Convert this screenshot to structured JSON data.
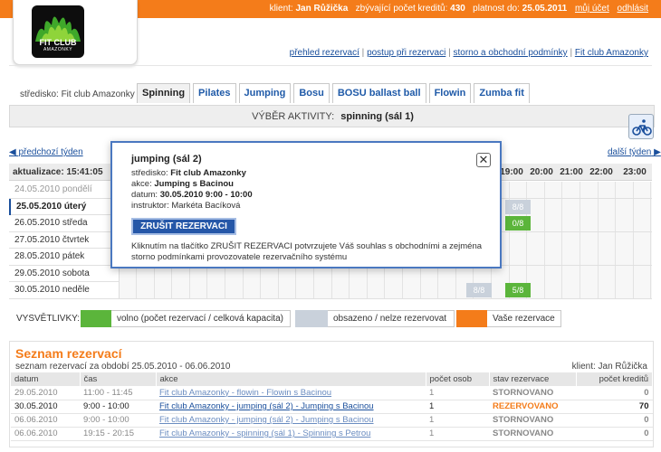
{
  "header": {
    "client_label": "klient:",
    "client_name": "Jan Růžička",
    "credits_label": "zbývající počet kreditů:",
    "credits_value": "430",
    "valid_label": "platnost do:",
    "valid_value": "25.05.2011",
    "my_account": "můj účet",
    "logout": "odhlásit"
  },
  "logo": {
    "line1": "FIT CLUB",
    "line2": "AMAZONKY"
  },
  "top_links": [
    "přehled rezervací",
    "postup při rezervaci",
    "storno a obchodní podmínky",
    "Fit club Amazonky"
  ],
  "stredisko_label": "středisko: Fit club Amazonky",
  "tabs": [
    "Spinning",
    "Pilates",
    "Jumping",
    "Bosu",
    "BOSU ballast ball",
    "Flowin",
    "Zumba fit"
  ],
  "activity": {
    "label": "VÝBĚR AKTIVITY:",
    "value": "spinning (sál 1)"
  },
  "nav": {
    "prev": "předchozí týden",
    "next": "další týden"
  },
  "grid": {
    "update_label": "aktualizace: 15:41:05",
    "hours": [
      "19:00",
      "20:00",
      "21:00",
      "22:00",
      "23:00"
    ],
    "days": [
      {
        "label": "24.05.2010 pondělí",
        "state": "past"
      },
      {
        "label": "25.05.2010 úterý",
        "state": "current"
      },
      {
        "label": "26.05.2010 středa",
        "state": ""
      },
      {
        "label": "27.05.2010 čtvrtek",
        "state": ""
      },
      {
        "label": "28.05.2010 pátek",
        "state": ""
      },
      {
        "label": "29.05.2010 sobota",
        "state": ""
      },
      {
        "label": "30.05.2010 neděle",
        "state": ""
      }
    ],
    "slots": [
      {
        "day": 1,
        "hour_index": 0,
        "text": "8/8",
        "kind": "full"
      },
      {
        "day": 2,
        "hour_index": 0,
        "text": "0/8",
        "kind": "free"
      },
      {
        "day": 6,
        "hour_index": -1,
        "text": "8/8",
        "kind": "full"
      },
      {
        "day": 6,
        "hour_index": 0,
        "text": "5/8",
        "kind": "free"
      }
    ]
  },
  "legend": {
    "title": "VYSVĚTLIVKY:",
    "items": [
      "volno (počet rezervací / celková kapacita)",
      "obsazeno / nelze rezervovat",
      "Vaše rezervace"
    ],
    "colors": {
      "free": "#5bb53b",
      "full": "#c9d1db",
      "mine": "#f47c1a"
    }
  },
  "seznam": {
    "title": "Seznam rezervací",
    "subtitle": "seznam rezervací za období 25.05.2010 - 06.06.2010",
    "client": "klient: Jan Růžička",
    "columns": [
      "datum",
      "čas",
      "akce",
      "počet osob",
      "stav rezervace",
      "počet kreditů"
    ],
    "rows": [
      {
        "datum": "29.05.2010",
        "cas": "11:00 - 11:45",
        "akce": "Fit club Amazonky - flowin - Flowin s Bacinou",
        "osob": "1",
        "stav": "STORNOVANO",
        "kredity": "0",
        "active": false
      },
      {
        "datum": "30.05.2010",
        "cas": "9:00 - 10:00",
        "akce": "Fit club Amazonky - jumping (sál 2) - Jumping s Bacinou",
        "osob": "1",
        "stav": "REZERVOVANO",
        "kredity": "70",
        "active": true
      },
      {
        "datum": "06.06.2010",
        "cas": "9:00 - 10:00",
        "akce": "Fit club Amazonky - jumping (sál 2) - Jumping s Bacinou",
        "osob": "1",
        "stav": "STORNOVANO",
        "kredity": "0",
        "active": false
      },
      {
        "datum": "06.06.2010",
        "cas": "19:15 - 20:15",
        "akce": "Fit club Amazonky - spinning (sál 1) - Spinning s Petrou",
        "osob": "1",
        "stav": "STORNOVANO",
        "kredity": "0",
        "active": false
      }
    ]
  },
  "modal": {
    "title": "jumping (sál 2)",
    "lines": [
      {
        "label": "středisko: ",
        "value": "Fit club Amazonky"
      },
      {
        "label": "akce: ",
        "value": "Jumping s Bacinou"
      },
      {
        "label": "datum: ",
        "value": "30.05.2010 9:00 - 10:00"
      },
      {
        "label": "instruktor: ",
        "value": "Markéta Bacíková"
      }
    ],
    "close_icon": "close-icon",
    "button": "ZRUŠIT REZERVACI",
    "note": "Kliknutím na tlačítko ZRUŠIT REZERVACI potvrzujete Váš souhlas s obchodními a zejména storno podmínkami provozovatele rezervačního systému"
  }
}
